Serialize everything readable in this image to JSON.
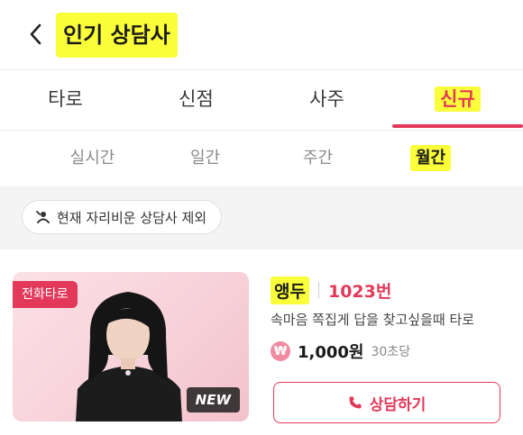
{
  "header": {
    "title": "인기 상담사"
  },
  "main_tabs": [
    {
      "label": "타로"
    },
    {
      "label": "신점"
    },
    {
      "label": "사주"
    },
    {
      "label": "신규"
    }
  ],
  "sub_tabs": [
    {
      "label": "실시간"
    },
    {
      "label": "일간"
    },
    {
      "label": "주간"
    },
    {
      "label": "월간"
    }
  ],
  "filter": {
    "label": "현재 자리비운 상담사 제외"
  },
  "counselor": {
    "category_badge": "전화타로",
    "new_badge": "NEW",
    "name": "앵두",
    "number": "1023번",
    "description": "속마음 쪽집게 답을 찾고싶을때 타로",
    "currency_symbol": "₩",
    "price": "1,000원",
    "price_unit": "30초당",
    "consult_label": "상담하기"
  },
  "colors": {
    "accent": "#e2395a",
    "highlight": "#fbff3a"
  }
}
